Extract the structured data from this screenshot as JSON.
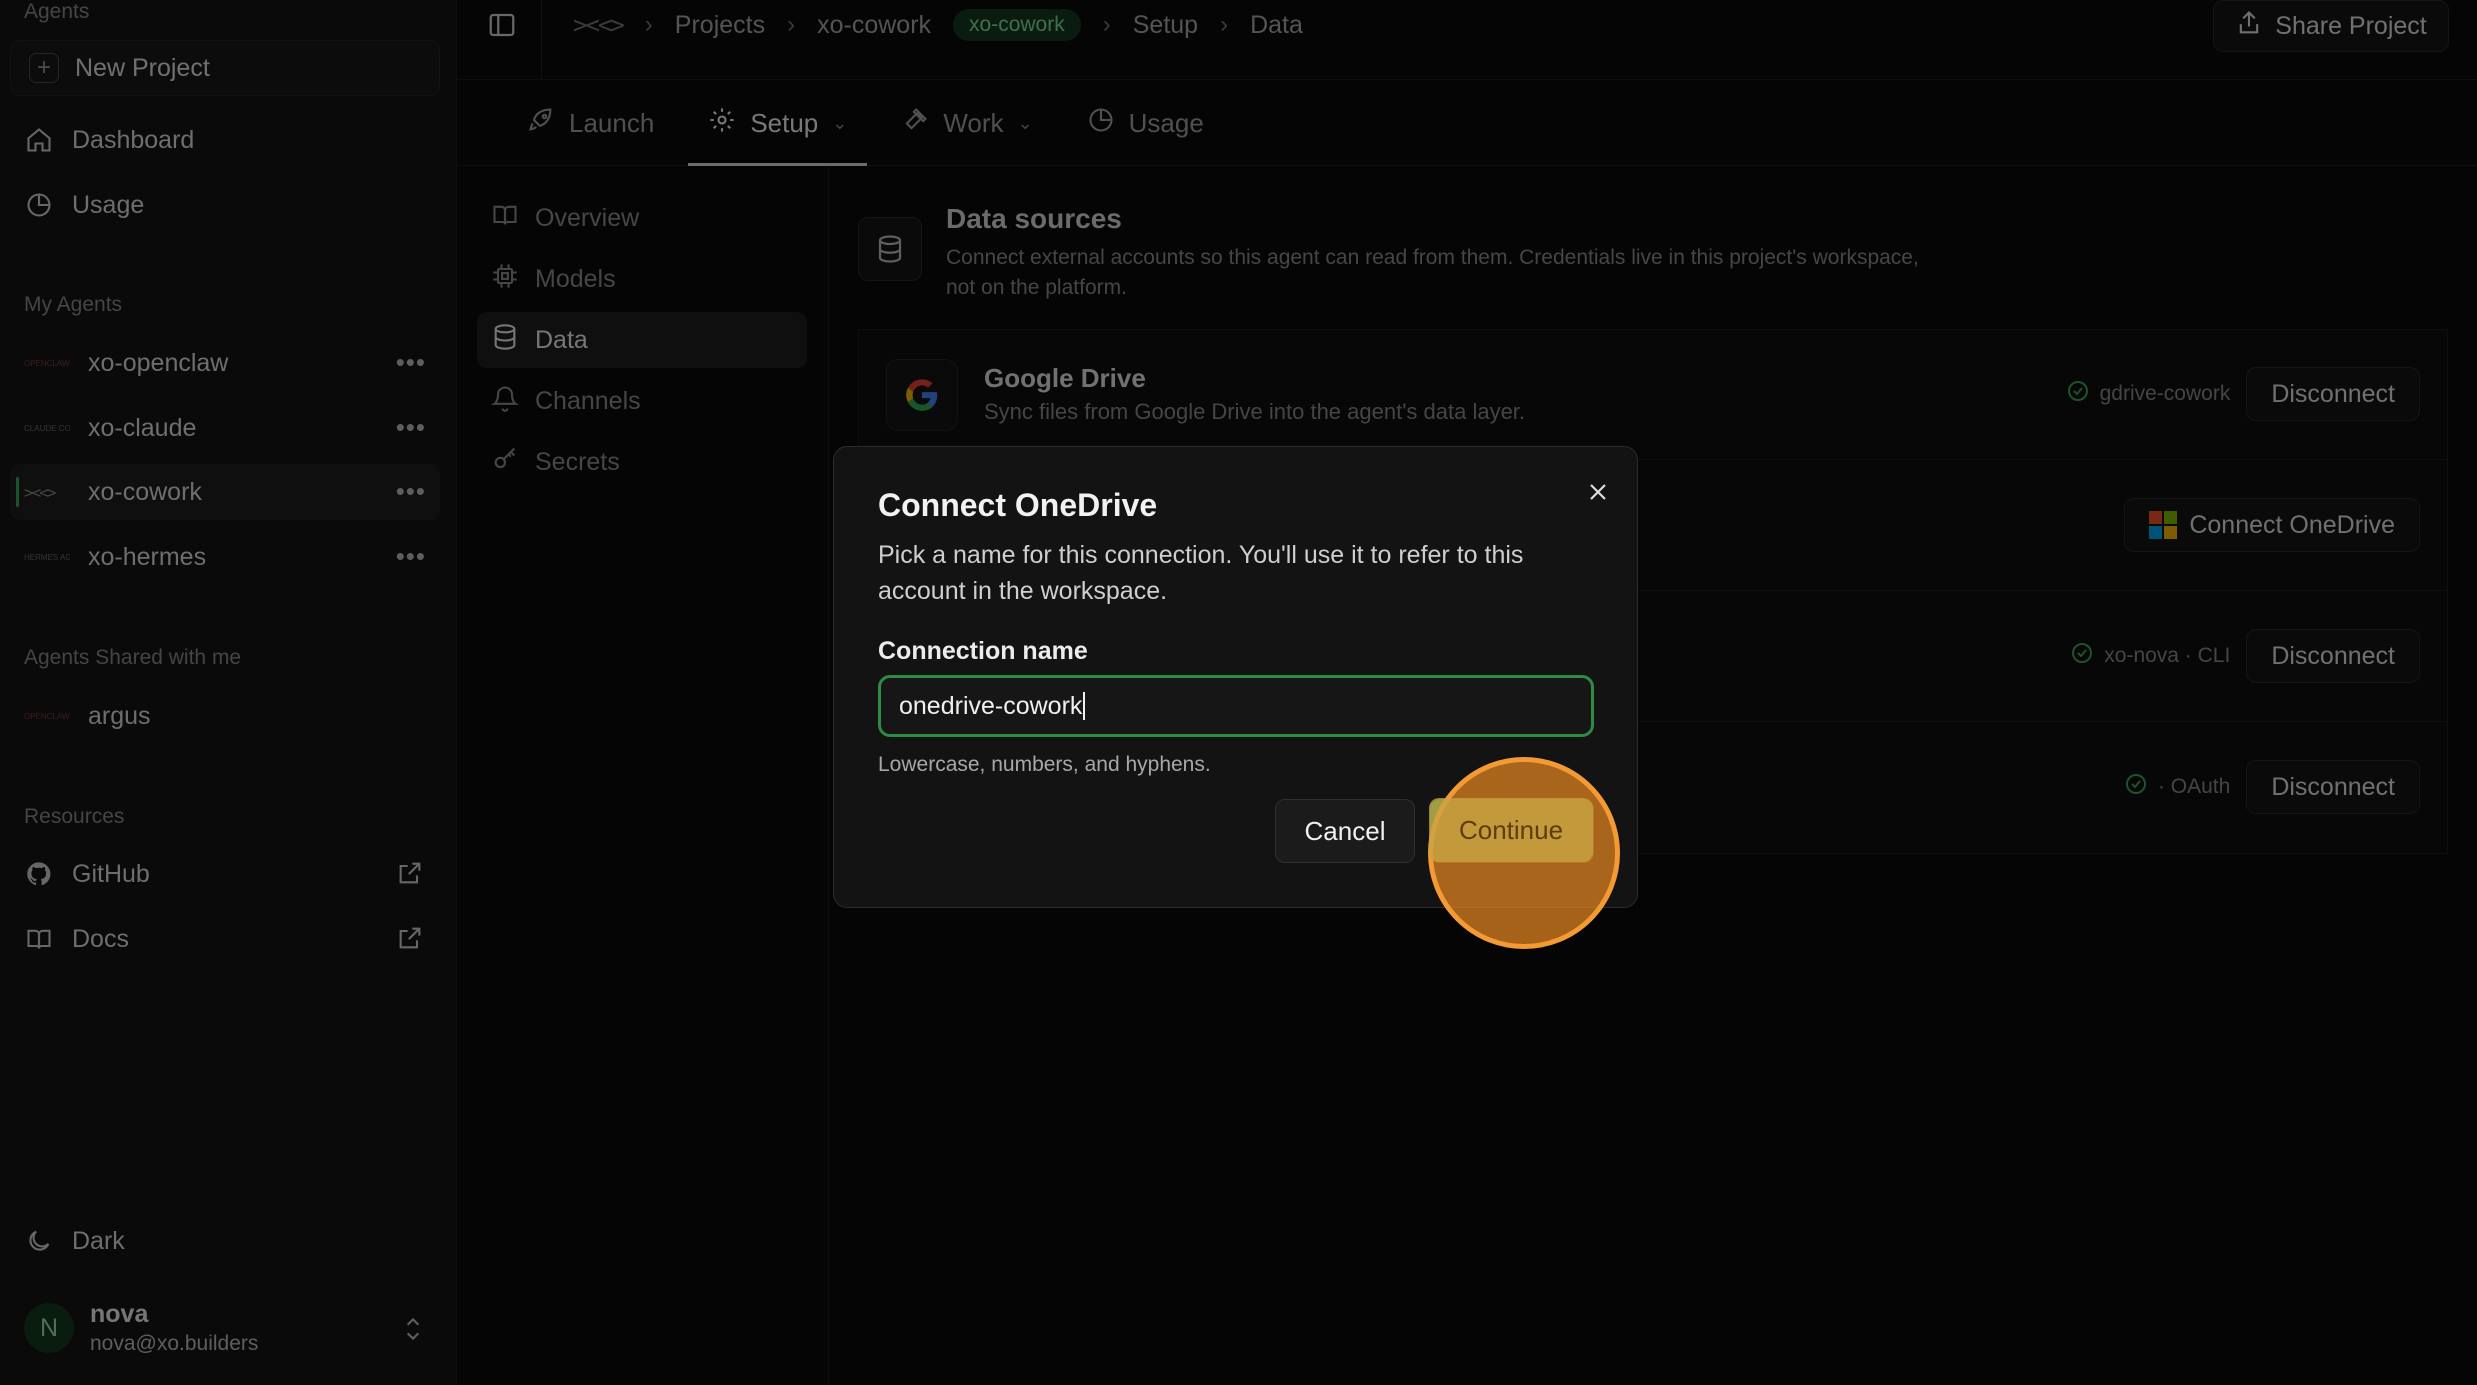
{
  "sidebar": {
    "section_top": "Agents",
    "new_project": "New Project",
    "nav": [
      {
        "label": "Dashboard",
        "icon": "home-icon"
      },
      {
        "label": "Usage",
        "icon": "pie-chart-icon"
      }
    ],
    "my_agents_label": "My Agents",
    "agents": [
      {
        "name": "xo-openclaw",
        "logo": "OPENCLAW"
      },
      {
        "name": "xo-claude",
        "logo": "CLAUDE CODE"
      },
      {
        "name": "xo-cowork",
        "logo": "><<>"
      },
      {
        "name": "xo-hermes",
        "logo": "HERMES AGENT"
      }
    ],
    "shared_label": "Agents Shared with me",
    "shared_agents": [
      {
        "name": "argus",
        "logo": "OPENCLAW"
      }
    ],
    "resources_label": "Resources",
    "resources": [
      {
        "label": "GitHub",
        "icon": "github-icon"
      },
      {
        "label": "Docs",
        "icon": "book-icon"
      }
    ],
    "theme_label": "Dark",
    "user": {
      "initial": "N",
      "name": "nova",
      "email": "nova@xo.builders"
    }
  },
  "topbar": {
    "breadcrumbs": [
      "Projects",
      "xo-cowork",
      "xo-cowork",
      "Setup",
      "Data"
    ],
    "share_label": "Share Project"
  },
  "tabs": [
    {
      "label": "Launch",
      "icon": "rocket-icon"
    },
    {
      "label": "Setup",
      "icon": "gear-icon"
    },
    {
      "label": "Work",
      "icon": "hammer-icon"
    },
    {
      "label": "Usage",
      "icon": "pie-chart-icon"
    }
  ],
  "subnav": [
    {
      "label": "Overview",
      "icon": "book-icon"
    },
    {
      "label": "Models",
      "icon": "cpu-icon"
    },
    {
      "label": "Data",
      "icon": "database-icon"
    },
    {
      "label": "Channels",
      "icon": "bell-icon"
    },
    {
      "label": "Secrets",
      "icon": "key-icon"
    }
  ],
  "main": {
    "title": "Data sources",
    "description": "Connect external accounts so this agent can read from them. Credentials live in this project's workspace, not on the platform.",
    "rows": [
      {
        "title": "Google Drive",
        "desc": "Sync files from Google Drive into the agent's data layer.",
        "status": "gdrive-cowork",
        "action": "Disconnect"
      },
      {
        "title": "",
        "desc": "",
        "status": "",
        "action": "Connect OneDrive"
      },
      {
        "title": "",
        "desc": "",
        "status": "xo-nova · CLI",
        "action": "Disconnect"
      },
      {
        "title": "",
        "desc": "",
        "status": "· OAuth",
        "action": "Disconnect"
      }
    ]
  },
  "modal": {
    "title": "Connect OneDrive",
    "description": "Pick a name for this connection. You'll use it to refer to this account in the workspace.",
    "field_label": "Connection name",
    "field_value": "onedrive-cowork",
    "hint": "Lowercase, numbers, and hyphens.",
    "cancel": "Cancel",
    "continue": "Continue"
  },
  "colors": {
    "accent_green": "#2e8a45",
    "badge_green_text": "#7ee09a",
    "click_indicator": "#f39a35"
  }
}
